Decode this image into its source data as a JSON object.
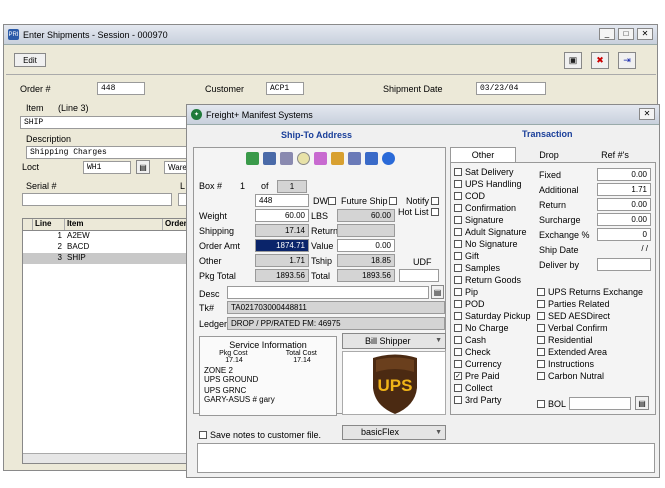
{
  "main": {
    "title": "Enter Shipments - Session - 000970",
    "menu_edit": "Edit",
    "order_label": "Order #",
    "order_value": "448",
    "customer_label": "Customer",
    "customer_value": "ACP1",
    "shipdate_label": "Shipment Date",
    "shipdate_value": "03/23/04",
    "item_label": "Item",
    "item_line": "(Line 3)",
    "item_value": "SHIP",
    "desc_label": "Description",
    "desc_value": "Shipping Charges",
    "loct_label": "Loct",
    "loct_value": "WH1",
    "ware_value": "Ware",
    "serial_label": "Serial #",
    "l_label": "L",
    "grid_cols": [
      "Line",
      "Item",
      "Order"
    ],
    "grid_rows": [
      {
        "line": "1",
        "item": "A2EW"
      },
      {
        "line": "2",
        "item": "BACD"
      },
      {
        "line": "3",
        "item": "SHIP"
      }
    ]
  },
  "fm": {
    "title": "Freight+ Manifest Systems",
    "shipto_header": "Ship-To Address",
    "transaction_header": "Transaction",
    "box_label": "Box #",
    "box_value": "1",
    "of_label": "of",
    "of_value": "1",
    "ref_value": "448",
    "dw_label": "DW",
    "future_label": "Future Ship",
    "notify_label": "Notify",
    "hotlist_label": "Hot List",
    "weight_label": "Weight",
    "weight_value": "60.00",
    "lbs_label": "LBS",
    "lbs_value": "60.00",
    "shipping_label": "Shipping",
    "shipping_value": "17.14",
    "return_label": "Return",
    "orderamt_label": "Order Amt",
    "orderamt_value": "1874.71",
    "value_label": "Value",
    "value_value": "0.00",
    "other_label": "Other",
    "other_value": "1.71",
    "tship_label": "Tship",
    "tship_value": "18.85",
    "udf_label": "UDF",
    "pkgtotal_label": "Pkg Total",
    "pkgtotal_value": "1893.56",
    "total_label": "Total",
    "total_value": "1893.56",
    "desc_label": "Desc",
    "tk_label": "Tk#",
    "tk_value": "TA021703000448811",
    "ledger_label": "Ledger",
    "ledger_value": "DROP / PP/RATED FM: 46975",
    "svc": {
      "title": "Service Information",
      "pkgcost_label": "Pkg Cost",
      "totalcost_label": "Total Cost",
      "pkgcost": "17.14",
      "totalcost": "17.14",
      "line1": "ZONE 2",
      "line2": "UPS GROUND",
      "line3": "UPS GRNC",
      "line4": "GARY-ASUS # gary"
    },
    "bill_value": "Bill Shipper",
    "ups_text": "UPS",
    "save_notes_label": "Save notes to customer file.",
    "flex_value": "basicFlex",
    "tabs": [
      "Other",
      "Drop",
      "Ref #'s"
    ],
    "options_left": [
      {
        "label": "Sat Delivery",
        "checked": false
      },
      {
        "label": "UPS Handling",
        "checked": false
      },
      {
        "label": "COD",
        "checked": false
      },
      {
        "label": "Confirmation",
        "checked": false
      },
      {
        "label": "Signature",
        "checked": false
      },
      {
        "label": "Adult Signature",
        "checked": false
      },
      {
        "label": "No Signature",
        "checked": false
      },
      {
        "label": "Gift",
        "checked": false
      },
      {
        "label": "Samples",
        "checked": false
      },
      {
        "label": "Return Goods",
        "checked": false
      },
      {
        "label": "Pip",
        "checked": false
      },
      {
        "label": "POD",
        "checked": false
      },
      {
        "label": "Saturday Pickup",
        "checked": false
      },
      {
        "label": "No Charge",
        "checked": false
      },
      {
        "label": "Cash",
        "checked": false
      },
      {
        "label": "Check",
        "checked": false
      },
      {
        "label": "Currency",
        "checked": false
      },
      {
        "label": "Pre Paid",
        "checked": true
      },
      {
        "label": "Collect",
        "checked": false
      },
      {
        "label": "3rd Party",
        "checked": false
      }
    ],
    "options_right": [
      {
        "label": "UPS Returns Exchange",
        "checked": false
      },
      {
        "label": "Parties Related",
        "checked": false
      },
      {
        "label": "SED AESDirect",
        "checked": false
      },
      {
        "label": "Verbal Confirm",
        "checked": false
      },
      {
        "label": "Residential",
        "checked": false
      },
      {
        "label": "Extended Area",
        "checked": false
      },
      {
        "label": "Instructions",
        "checked": false
      },
      {
        "label": "Carbon Nutral",
        "checked": false
      }
    ],
    "bol_label": "BOL",
    "trans": [
      {
        "label": "Fixed",
        "value": "0.00"
      },
      {
        "label": "Additional",
        "value": "1.71"
      },
      {
        "label": "Return",
        "value": "0.00"
      },
      {
        "label": "Surcharge",
        "value": "0.00"
      },
      {
        "label": "Exchange %",
        "value": "0"
      },
      {
        "label": "Ship Date",
        "value": "/ /"
      },
      {
        "label": "Deliver by",
        "value": ""
      }
    ]
  }
}
